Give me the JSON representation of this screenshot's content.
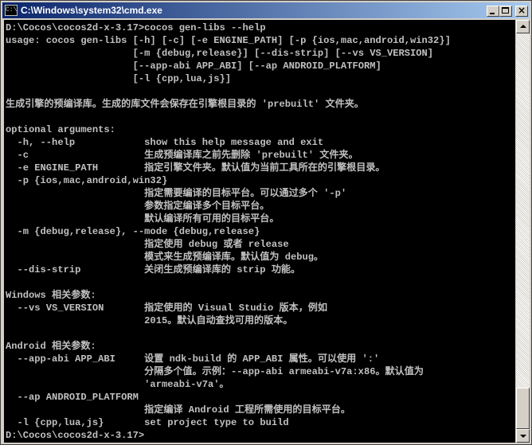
{
  "window": {
    "title": "C:\\Windows\\system32\\cmd.exe",
    "icon_label": "C:\\",
    "controls": {
      "minimize": "minimize-icon",
      "maximize": "maximize-icon",
      "close": "×"
    }
  },
  "console": {
    "lines": [
      "D:\\Cocos\\cocos2d-x-3.17>cocos gen-libs --help",
      "usage: cocos gen-libs [-h] [-c] [-e ENGINE_PATH] [-p {ios,mac,android,win32}]",
      "                      [-m {debug,release}] [--dis-strip] [--vs VS_VERSION]",
      "                      [--app-abi APP_ABI] [--ap ANDROID_PLATFORM]",
      "                      [-l {cpp,lua,js}]",
      "",
      "生成引擎的预编译库。生成的库文件会保存在引擎根目录的 'prebuilt' 文件夹。",
      "",
      "optional arguments:",
      "  -h, --help            show this help message and exit",
      "  -c                    生成预编译库之前先删除 'prebuilt' 文件夹。",
      "  -e ENGINE_PATH        指定引擎文件夹。默认值为当前工具所在的引擎根目录。",
      "  -p {ios,mac,android,win32}",
      "                        指定需要编译的目标平台。可以通过多个 '-p'",
      "                        参数指定编译多个目标平台。",
      "                        默认编译所有可用的目标平台。",
      "  -m {debug,release}, --mode {debug,release}",
      "                        指定使用 debug 或者 release",
      "                        模式来生成预编译库。默认值为 debug。",
      "  --dis-strip           关闭生成预编译库的 strip 功能。",
      "",
      "Windows 相关参数:",
      "  --vs VS_VERSION       指定使用的 Visual Studio 版本，例如",
      "                        2015。默认自动查找可用的版本。",
      "",
      "Android 相关参数:",
      "  --app-abi APP_ABI     设置 ndk-build 的 APP_ABI 属性。可以使用 ':'",
      "                        分隔多个值。示例：--app-abi armeabi-v7a:x86。默认值为",
      "                        'armeabi-v7a'。",
      "  --ap ANDROID_PLATFORM",
      "                        指定编译 Android 工程所需使用的目标平台。",
      "  -l {cpp,lua,js}       set project type to build",
      "D:\\Cocos\\cocos2d-x-3.17>"
    ]
  },
  "colors": {
    "console_bg": "#000000",
    "console_fg": "#c0c0c0",
    "title_start": "#0a246a",
    "title_end": "#a6caf0"
  }
}
